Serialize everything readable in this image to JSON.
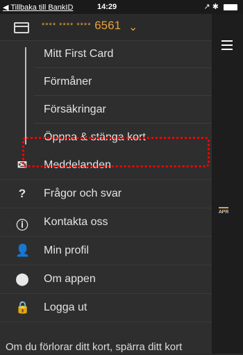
{
  "status_bar": {
    "back_label": "◀ Tillbaka till BankID",
    "time": "14:29",
    "indicators": "↗ ✱"
  },
  "card": {
    "masked_prefix": "**** **** ****",
    "last_digits": "6561",
    "chevron": "⌄"
  },
  "submenu": [
    {
      "label": "Mitt First Card"
    },
    {
      "label": "Förmåner"
    },
    {
      "label": "Försäkringar"
    },
    {
      "label": "Öppna & stänga kort"
    }
  ],
  "menu": [
    {
      "label": "Meddelanden",
      "icon": "envelope-icon"
    },
    {
      "label": "Frågor och svar",
      "icon": "question-icon"
    },
    {
      "label": "Kontakta oss",
      "icon": "info-icon"
    },
    {
      "label": "Min profil",
      "icon": "person-icon"
    },
    {
      "label": "Om appen",
      "icon": "location-pin-icon"
    },
    {
      "label": "Logga ut",
      "icon": "lock-icon"
    }
  ],
  "background_panel": {
    "tab_label": "APR"
  },
  "bottom_text": "Om du förlorar ditt kort, spärra ditt kort"
}
